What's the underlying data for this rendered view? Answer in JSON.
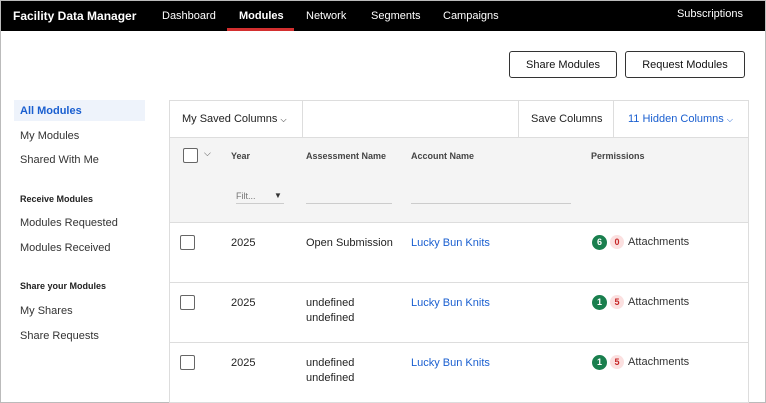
{
  "nav": {
    "brand": "Facility Data Manager",
    "links": [
      "Dashboard",
      "Modules",
      "Network",
      "Segments",
      "Campaigns"
    ],
    "active": "Modules",
    "right_link": "Subscriptions"
  },
  "actions": {
    "share_label": "Share Modules",
    "request_label": "Request Modules"
  },
  "sidebar": {
    "items": [
      "All Modules",
      "My Modules",
      "Shared With Me"
    ],
    "active": "All Modules",
    "receive_heading": "Receive Modules",
    "receive_items": [
      "Modules Requested",
      "Modules Received"
    ],
    "share_heading": "Share your Modules",
    "share_items": [
      "My Shares",
      "Share Requests"
    ]
  },
  "toolbar": {
    "saved_columns": "My Saved Columns",
    "save_columns": "Save Columns",
    "hidden_columns": "11 Hidden Columns"
  },
  "table": {
    "headers": {
      "year": "Year",
      "assessment": "Assessment Name",
      "account": "Account Name",
      "permissions": "Permissions"
    },
    "year_filter_placeholder": "Filt...",
    "rows": [
      {
        "year": "2025",
        "assessment": "Open Submission",
        "account": "Lucky Bun Knits",
        "green": "6",
        "red": "0",
        "attachments": "Attachments"
      },
      {
        "year": "2025",
        "assessment": "undefined\nundefined",
        "account": "Lucky Bun Knits",
        "green": "1",
        "red": "5",
        "attachments": "Attachments"
      },
      {
        "year": "2025",
        "assessment": "undefined\nundefined",
        "account": "Lucky Bun Knits",
        "green": "1",
        "red": "5",
        "attachments": "Attachments"
      }
    ]
  },
  "colors": {
    "accent": "#1a5fd0",
    "nav_underline": "#d32f2f",
    "badge_green": "#1a7f4e",
    "badge_red_text": "#c62828"
  }
}
